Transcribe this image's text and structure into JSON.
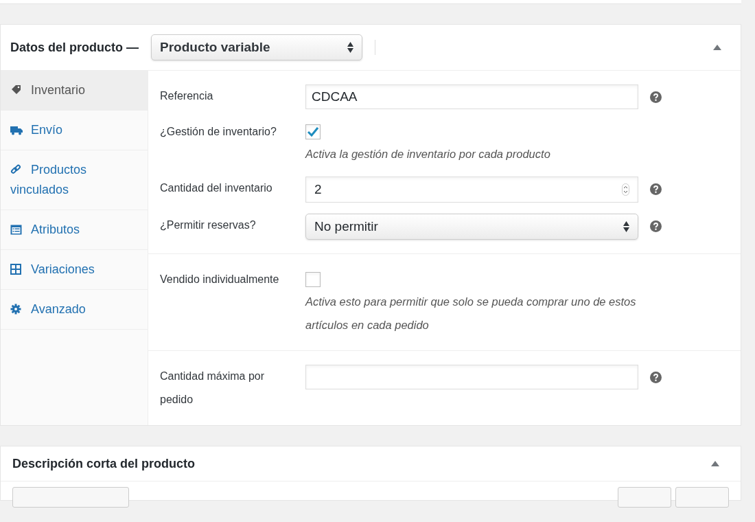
{
  "product_data": {
    "title": "Datos del producto —",
    "type_select": {
      "value": "Producto variable"
    },
    "tabs": [
      {
        "label": "Inventario",
        "selected": true
      },
      {
        "label": "Envío",
        "selected": false
      },
      {
        "label": "Productos vinculados",
        "selected": false
      },
      {
        "label": "Atributos",
        "selected": false
      },
      {
        "label": "Variaciones",
        "selected": false
      },
      {
        "label": "Avanzado",
        "selected": false
      }
    ],
    "groups": [
      [
        {
          "kind": "text",
          "label": "Referencia",
          "value": "CDCAA",
          "help": true
        },
        {
          "kind": "checkbox",
          "label": "¿Gestión de inventario?",
          "checked": true,
          "description": "Activa la gestión de inventario por cada producto"
        },
        {
          "kind": "number",
          "label": "Cantidad del inventario",
          "value": "2",
          "help": true
        },
        {
          "kind": "select",
          "label": "¿Permitir reservas?",
          "value": "No permitir",
          "help": true
        }
      ],
      [
        {
          "kind": "checkbox",
          "label": "Vendido individualmente",
          "checked": false,
          "description": "Activa esto para permitir que solo se pueda comprar uno de estos artículos en cada pedido"
        }
      ],
      [
        {
          "kind": "text",
          "label": "Cantidad máxima por pedido",
          "help": true
        }
      ]
    ]
  },
  "short_description": {
    "title": "Descripción corta del producto"
  }
}
